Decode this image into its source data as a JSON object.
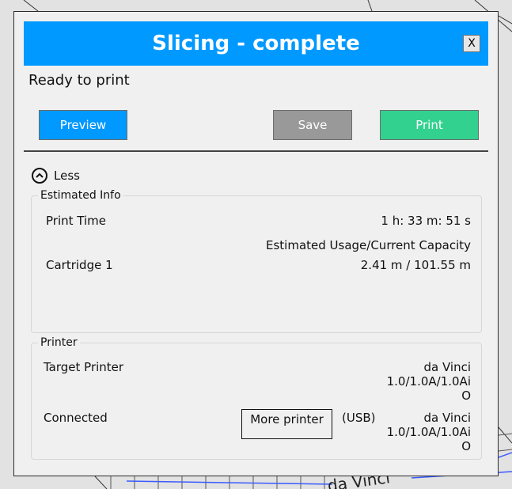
{
  "dialog": {
    "title": "Slicing - complete",
    "close_label": "X",
    "status": "Ready to print"
  },
  "actions": {
    "preview_label": "Preview",
    "save_label": "Save",
    "print_label": "Print"
  },
  "toggle": {
    "label": "Less",
    "icon": "chevron-up-icon"
  },
  "estimated_info": {
    "title": "Estimated Info",
    "print_time_label": "Print Time",
    "print_time_value": "1 h: 33 m: 51 s",
    "usage_header": "Estimated Usage/Current Capacity",
    "cartridge_label": "Cartridge 1",
    "cartridge_value": "2.41 m / 101.55 m"
  },
  "printer": {
    "title": "Printer",
    "target_label": "Target Printer",
    "target_value": "da Vinci\n1.0/1.0A/1.0Ai\nO",
    "connected_label": "Connected",
    "more_printer_label": "More printer",
    "connection_type": "(USB)",
    "connected_value": "da Vinci\n1.0/1.0A/1.0Ai\nO"
  },
  "background": {
    "partial_text": "da Vinci"
  }
}
